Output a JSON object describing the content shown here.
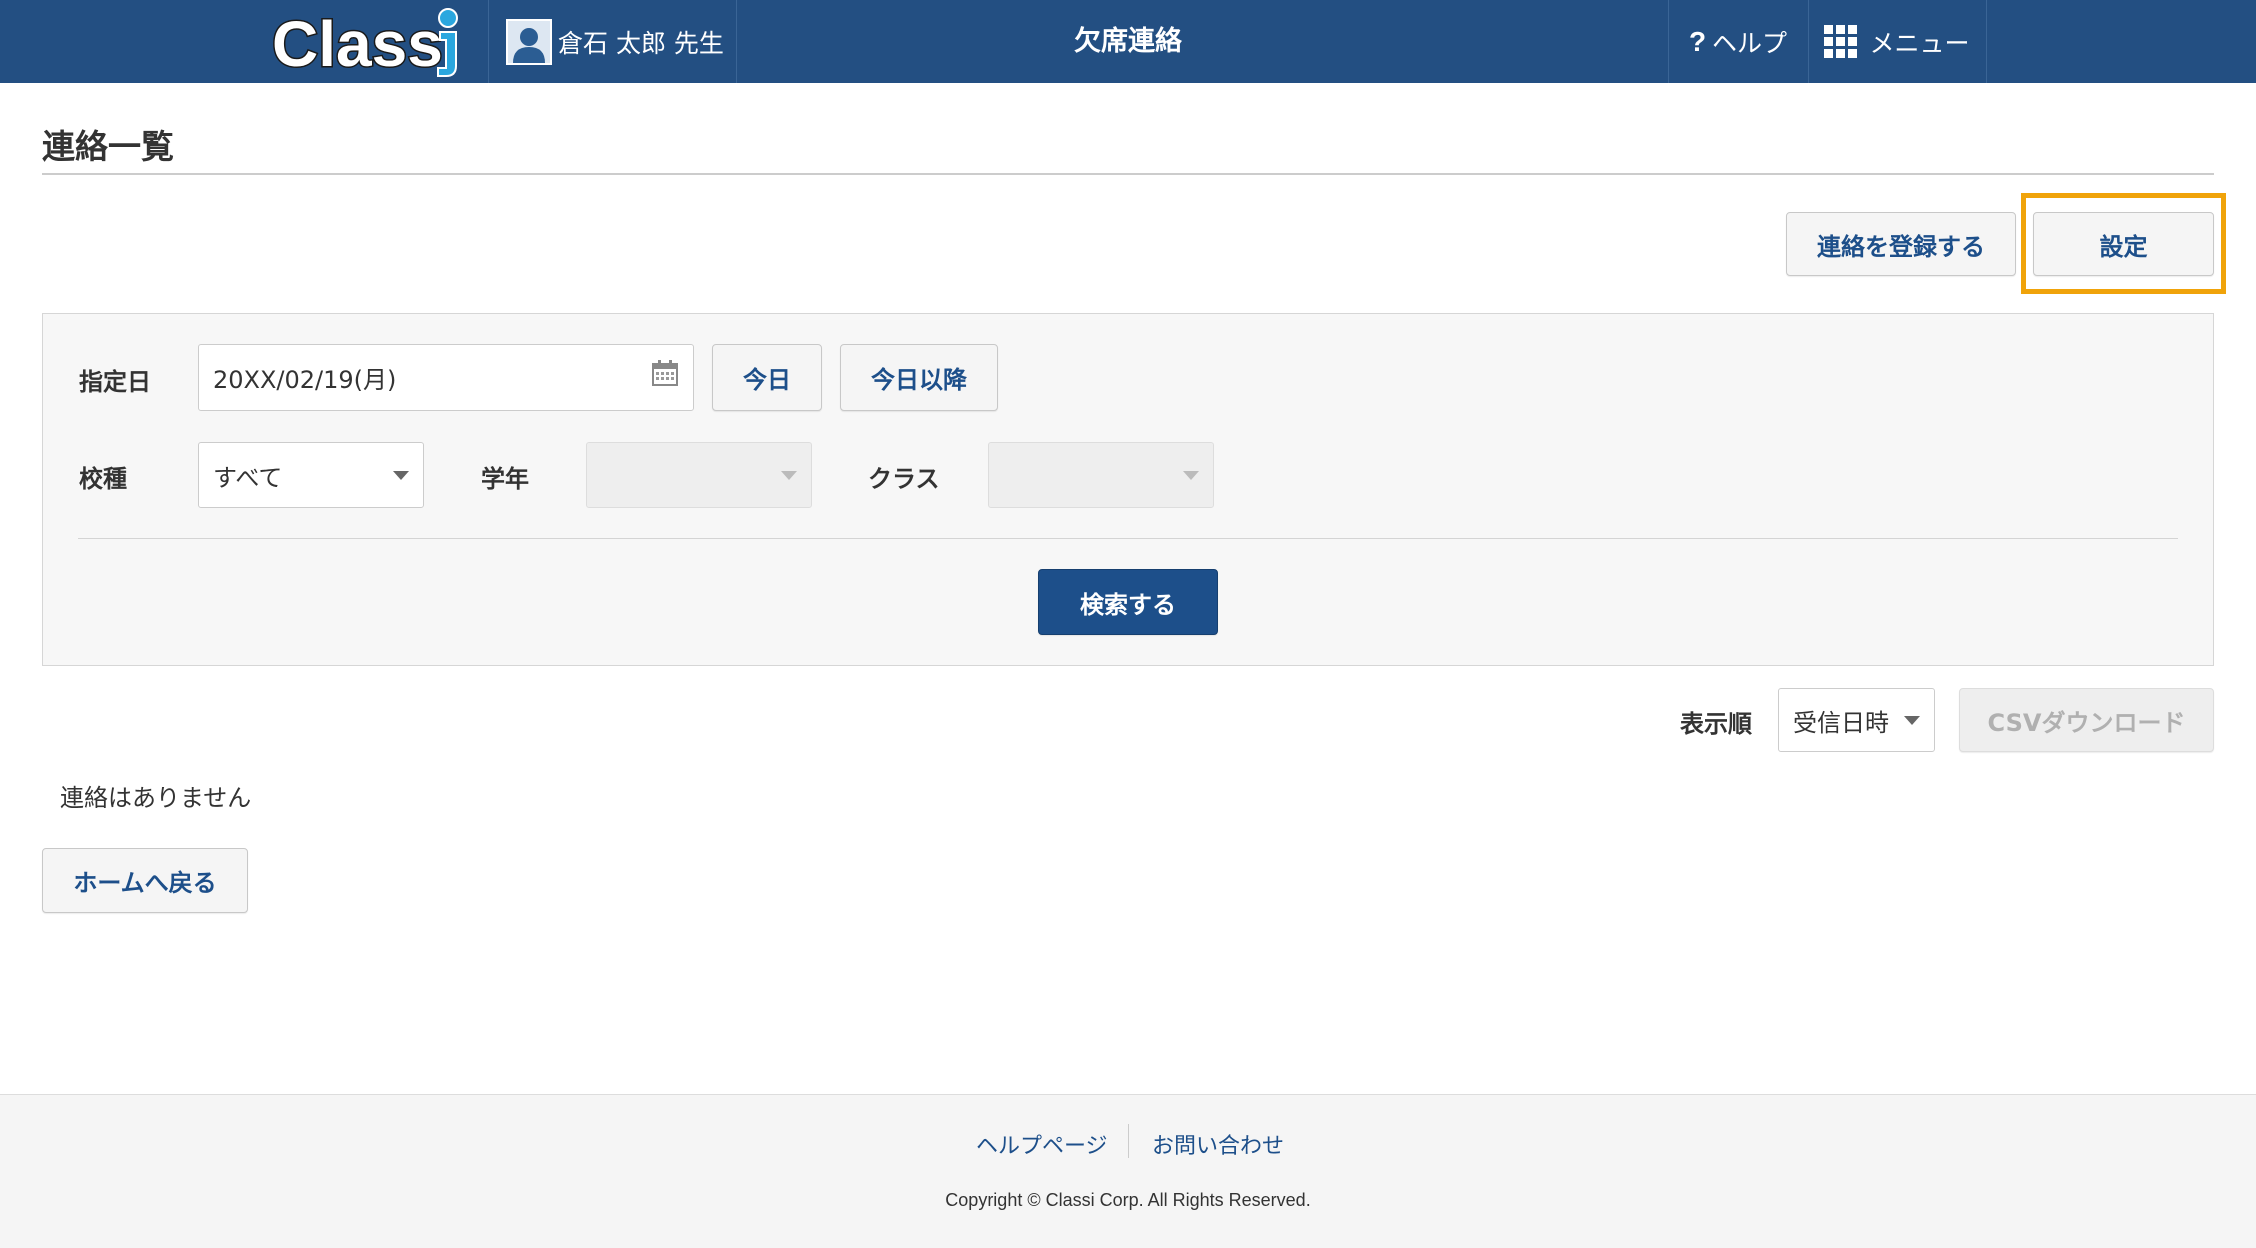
{
  "header": {
    "logo_text": "Classi",
    "user_name": "倉石 太郎 先生",
    "app_title": "欠席連絡",
    "help_label": "ヘルプ",
    "menu_label": "メニュー"
  },
  "page": {
    "title": "連絡一覧"
  },
  "actions": {
    "register_label": "連絡を登録する",
    "settings_label": "設定"
  },
  "search": {
    "date_label": "指定日",
    "date_value": "20XX/02/19(月)",
    "today_label": "今日",
    "from_today_label": "今日以降",
    "school_type_label": "校種",
    "school_type_value": "すべて",
    "grade_label": "学年",
    "grade_value": "",
    "class_label": "クラス",
    "class_value": "",
    "submit_label": "検索する"
  },
  "results": {
    "sort_label": "表示順",
    "sort_value": "受信日時",
    "csv_label": "CSVダウンロード",
    "empty_message": "連絡はありません",
    "back_home_label": "ホームへ戻る"
  },
  "footer": {
    "help_page_label": "ヘルプページ",
    "contact_label": "お問い合わせ",
    "copyright": "Copyright © Classi Corp. All Rights Reserved."
  },
  "colors": {
    "header_bg": "#234f82",
    "accent_blue": "#1d4f8a",
    "highlight_orange": "#f0a30a"
  }
}
